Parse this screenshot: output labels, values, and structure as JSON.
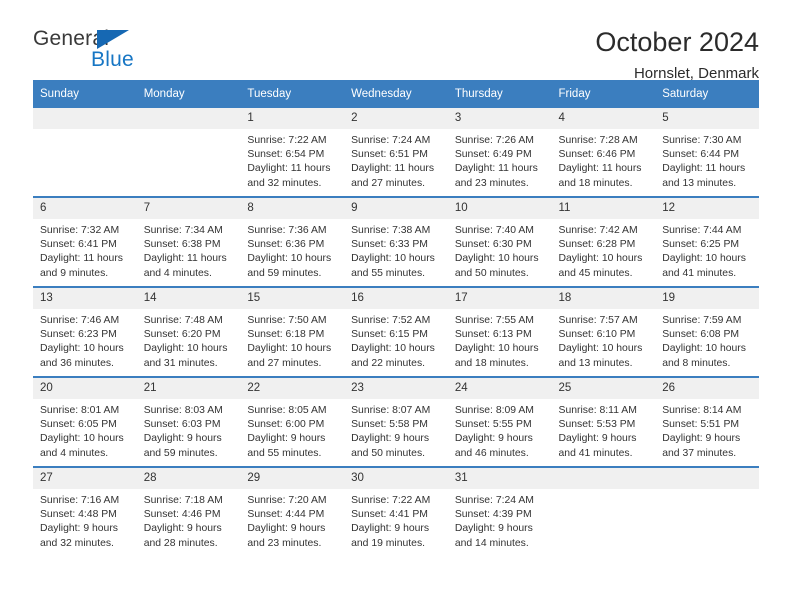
{
  "brand": {
    "word_one": "General",
    "word_two": "Blue",
    "triangle_color": "#1668b3",
    "blue_color": "#1776c4"
  },
  "header": {
    "title": "October 2024",
    "location": "Hornslet, Denmark"
  },
  "theme": {
    "header_blue": "#3b7ebf",
    "daynum_gray": "#f0f0f0",
    "text": "#333333"
  },
  "weekday_headers": [
    "Sunday",
    "Monday",
    "Tuesday",
    "Wednesday",
    "Thursday",
    "Friday",
    "Saturday"
  ],
  "weeks": [
    [
      {
        "day": "",
        "sunrise": "",
        "sunset": "",
        "daylight_line1": "",
        "daylight_line2": "",
        "blank": true
      },
      {
        "day": "",
        "sunrise": "",
        "sunset": "",
        "daylight_line1": "",
        "daylight_line2": "",
        "blank": true
      },
      {
        "day": "1",
        "sunrise": "Sunrise: 7:22 AM",
        "sunset": "Sunset: 6:54 PM",
        "daylight_line1": "Daylight: 11 hours",
        "daylight_line2": "and 32 minutes."
      },
      {
        "day": "2",
        "sunrise": "Sunrise: 7:24 AM",
        "sunset": "Sunset: 6:51 PM",
        "daylight_line1": "Daylight: 11 hours",
        "daylight_line2": "and 27 minutes."
      },
      {
        "day": "3",
        "sunrise": "Sunrise: 7:26 AM",
        "sunset": "Sunset: 6:49 PM",
        "daylight_line1": "Daylight: 11 hours",
        "daylight_line2": "and 23 minutes."
      },
      {
        "day": "4",
        "sunrise": "Sunrise: 7:28 AM",
        "sunset": "Sunset: 6:46 PM",
        "daylight_line1": "Daylight: 11 hours",
        "daylight_line2": "and 18 minutes."
      },
      {
        "day": "5",
        "sunrise": "Sunrise: 7:30 AM",
        "sunset": "Sunset: 6:44 PM",
        "daylight_line1": "Daylight: 11 hours",
        "daylight_line2": "and 13 minutes."
      }
    ],
    [
      {
        "day": "6",
        "sunrise": "Sunrise: 7:32 AM",
        "sunset": "Sunset: 6:41 PM",
        "daylight_line1": "Daylight: 11 hours",
        "daylight_line2": "and 9 minutes."
      },
      {
        "day": "7",
        "sunrise": "Sunrise: 7:34 AM",
        "sunset": "Sunset: 6:38 PM",
        "daylight_line1": "Daylight: 11 hours",
        "daylight_line2": "and 4 minutes."
      },
      {
        "day": "8",
        "sunrise": "Sunrise: 7:36 AM",
        "sunset": "Sunset: 6:36 PM",
        "daylight_line1": "Daylight: 10 hours",
        "daylight_line2": "and 59 minutes."
      },
      {
        "day": "9",
        "sunrise": "Sunrise: 7:38 AM",
        "sunset": "Sunset: 6:33 PM",
        "daylight_line1": "Daylight: 10 hours",
        "daylight_line2": "and 55 minutes."
      },
      {
        "day": "10",
        "sunrise": "Sunrise: 7:40 AM",
        "sunset": "Sunset: 6:30 PM",
        "daylight_line1": "Daylight: 10 hours",
        "daylight_line2": "and 50 minutes."
      },
      {
        "day": "11",
        "sunrise": "Sunrise: 7:42 AM",
        "sunset": "Sunset: 6:28 PM",
        "daylight_line1": "Daylight: 10 hours",
        "daylight_line2": "and 45 minutes."
      },
      {
        "day": "12",
        "sunrise": "Sunrise: 7:44 AM",
        "sunset": "Sunset: 6:25 PM",
        "daylight_line1": "Daylight: 10 hours",
        "daylight_line2": "and 41 minutes."
      }
    ],
    [
      {
        "day": "13",
        "sunrise": "Sunrise: 7:46 AM",
        "sunset": "Sunset: 6:23 PM",
        "daylight_line1": "Daylight: 10 hours",
        "daylight_line2": "and 36 minutes."
      },
      {
        "day": "14",
        "sunrise": "Sunrise: 7:48 AM",
        "sunset": "Sunset: 6:20 PM",
        "daylight_line1": "Daylight: 10 hours",
        "daylight_line2": "and 31 minutes."
      },
      {
        "day": "15",
        "sunrise": "Sunrise: 7:50 AM",
        "sunset": "Sunset: 6:18 PM",
        "daylight_line1": "Daylight: 10 hours",
        "daylight_line2": "and 27 minutes."
      },
      {
        "day": "16",
        "sunrise": "Sunrise: 7:52 AM",
        "sunset": "Sunset: 6:15 PM",
        "daylight_line1": "Daylight: 10 hours",
        "daylight_line2": "and 22 minutes."
      },
      {
        "day": "17",
        "sunrise": "Sunrise: 7:55 AM",
        "sunset": "Sunset: 6:13 PM",
        "daylight_line1": "Daylight: 10 hours",
        "daylight_line2": "and 18 minutes."
      },
      {
        "day": "18",
        "sunrise": "Sunrise: 7:57 AM",
        "sunset": "Sunset: 6:10 PM",
        "daylight_line1": "Daylight: 10 hours",
        "daylight_line2": "and 13 minutes."
      },
      {
        "day": "19",
        "sunrise": "Sunrise: 7:59 AM",
        "sunset": "Sunset: 6:08 PM",
        "daylight_line1": "Daylight: 10 hours",
        "daylight_line2": "and 8 minutes."
      }
    ],
    [
      {
        "day": "20",
        "sunrise": "Sunrise: 8:01 AM",
        "sunset": "Sunset: 6:05 PM",
        "daylight_line1": "Daylight: 10 hours",
        "daylight_line2": "and 4 minutes."
      },
      {
        "day": "21",
        "sunrise": "Sunrise: 8:03 AM",
        "sunset": "Sunset: 6:03 PM",
        "daylight_line1": "Daylight: 9 hours",
        "daylight_line2": "and 59 minutes."
      },
      {
        "day": "22",
        "sunrise": "Sunrise: 8:05 AM",
        "sunset": "Sunset: 6:00 PM",
        "daylight_line1": "Daylight: 9 hours",
        "daylight_line2": "and 55 minutes."
      },
      {
        "day": "23",
        "sunrise": "Sunrise: 8:07 AM",
        "sunset": "Sunset: 5:58 PM",
        "daylight_line1": "Daylight: 9 hours",
        "daylight_line2": "and 50 minutes."
      },
      {
        "day": "24",
        "sunrise": "Sunrise: 8:09 AM",
        "sunset": "Sunset: 5:55 PM",
        "daylight_line1": "Daylight: 9 hours",
        "daylight_line2": "and 46 minutes."
      },
      {
        "day": "25",
        "sunrise": "Sunrise: 8:11 AM",
        "sunset": "Sunset: 5:53 PM",
        "daylight_line1": "Daylight: 9 hours",
        "daylight_line2": "and 41 minutes."
      },
      {
        "day": "26",
        "sunrise": "Sunrise: 8:14 AM",
        "sunset": "Sunset: 5:51 PM",
        "daylight_line1": "Daylight: 9 hours",
        "daylight_line2": "and 37 minutes."
      }
    ],
    [
      {
        "day": "27",
        "sunrise": "Sunrise: 7:16 AM",
        "sunset": "Sunset: 4:48 PM",
        "daylight_line1": "Daylight: 9 hours",
        "daylight_line2": "and 32 minutes."
      },
      {
        "day": "28",
        "sunrise": "Sunrise: 7:18 AM",
        "sunset": "Sunset: 4:46 PM",
        "daylight_line1": "Daylight: 9 hours",
        "daylight_line2": "and 28 minutes."
      },
      {
        "day": "29",
        "sunrise": "Sunrise: 7:20 AM",
        "sunset": "Sunset: 4:44 PM",
        "daylight_line1": "Daylight: 9 hours",
        "daylight_line2": "and 23 minutes."
      },
      {
        "day": "30",
        "sunrise": "Sunrise: 7:22 AM",
        "sunset": "Sunset: 4:41 PM",
        "daylight_line1": "Daylight: 9 hours",
        "daylight_line2": "and 19 minutes."
      },
      {
        "day": "31",
        "sunrise": "Sunrise: 7:24 AM",
        "sunset": "Sunset: 4:39 PM",
        "daylight_line1": "Daylight: 9 hours",
        "daylight_line2": "and 14 minutes."
      },
      {
        "day": "",
        "sunrise": "",
        "sunset": "",
        "daylight_line1": "",
        "daylight_line2": "",
        "blank": true
      },
      {
        "day": "",
        "sunrise": "",
        "sunset": "",
        "daylight_line1": "",
        "daylight_line2": "",
        "blank": true
      }
    ]
  ]
}
